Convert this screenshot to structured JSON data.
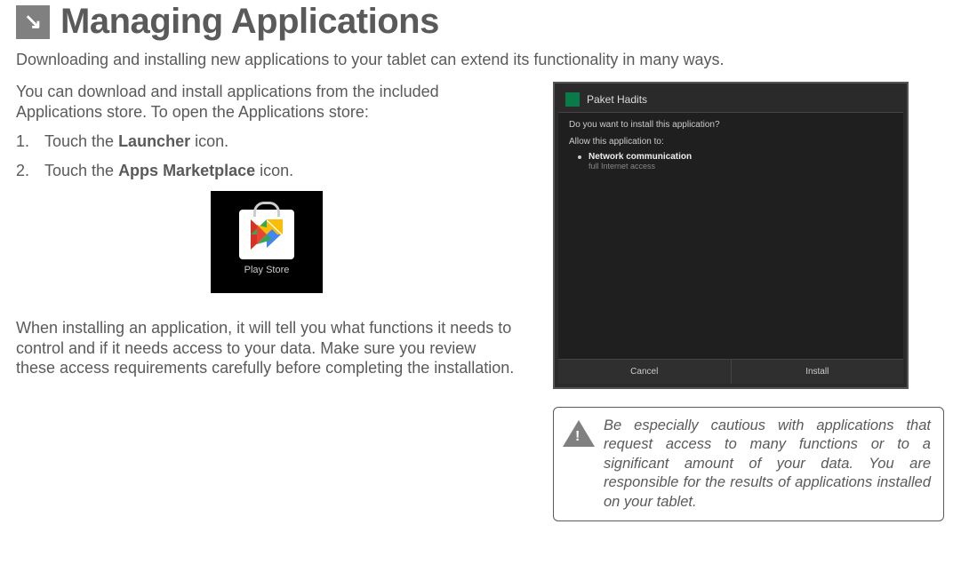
{
  "page": {
    "title": "Managing Applications",
    "subtitle": "Downloading and installing new applications to your tablet can extend its functionality in many ways."
  },
  "intro": "You can download and install applications from the included Applications store. To open the Applications store:",
  "steps": [
    {
      "num": "1.",
      "prefix": "Touch the ",
      "bold": "Launcher",
      "suffix": " icon."
    },
    {
      "num": "2.",
      "prefix": "Touch the ",
      "bold": "Apps Marketplace",
      "suffix": " icon."
    }
  ],
  "playstore_label": "Play Store",
  "install_review": "When installing an application, it will tell you what functions it needs to control and if it needs access to your data. Make sure you review these access requirements carefully before completing the installation.",
  "install_dialog": {
    "app_name": "Paket Hadits",
    "question": "Do you want to install this application?",
    "allow_label": "Allow this application to:",
    "permissions": [
      {
        "title": "Network communication",
        "sub": "full Internet access"
      }
    ],
    "cancel": "Cancel",
    "install": "Install"
  },
  "warning": "Be especially cautious with applications that request access to many functions or to a significant amount of your data. You are responsible for the results of applications installed on your tablet."
}
